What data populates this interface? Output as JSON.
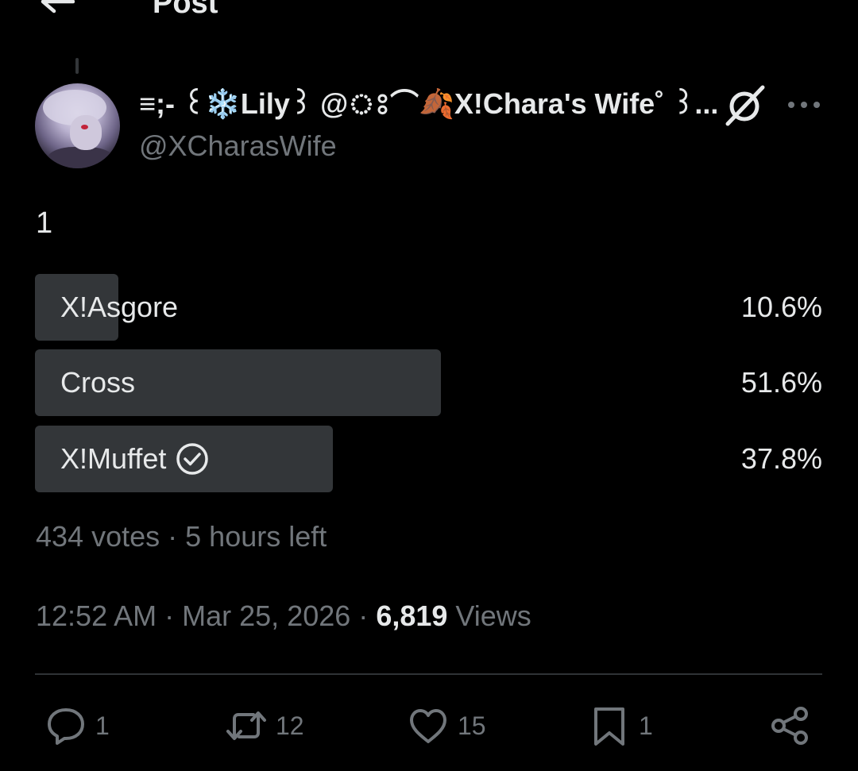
{
  "header": {
    "title": "Post"
  },
  "author": {
    "display_name": "≡;- ꒰❄️Lily꒱ @ঃ⌒🍂X!Chara's Wife˚ ꒱...",
    "handle": "@XCharasWife"
  },
  "post": {
    "text": "1"
  },
  "poll": {
    "options": [
      {
        "label": "X!Asgore",
        "percent_text": "10.6%",
        "percent": 10.6,
        "selected": false
      },
      {
        "label": "Cross",
        "percent_text": "51.6%",
        "percent": 51.6,
        "selected": false
      },
      {
        "label": "X!Muffet",
        "percent_text": "37.8%",
        "percent": 37.8,
        "selected": true
      }
    ],
    "votes": "434 votes",
    "separator": "·",
    "time_left": "5 hours left"
  },
  "meta": {
    "time": "12:52 AM",
    "date": "Mar 25, 2026",
    "separator": "·",
    "views_count": "6,819",
    "views_label": "Views"
  },
  "actions": {
    "replies": "1",
    "reposts": "12",
    "likes": "15",
    "bookmarks": "1"
  },
  "icons": [
    "back-arrow-icon",
    "grok-icon",
    "more-icon",
    "check-circle-icon",
    "reply-icon",
    "repost-icon",
    "like-icon",
    "bookmark-icon",
    "share-icon"
  ],
  "colors": {
    "background": "#000000",
    "text": "#e7e9ea",
    "secondary_text": "#71767b",
    "poll_bar": "#333639"
  }
}
